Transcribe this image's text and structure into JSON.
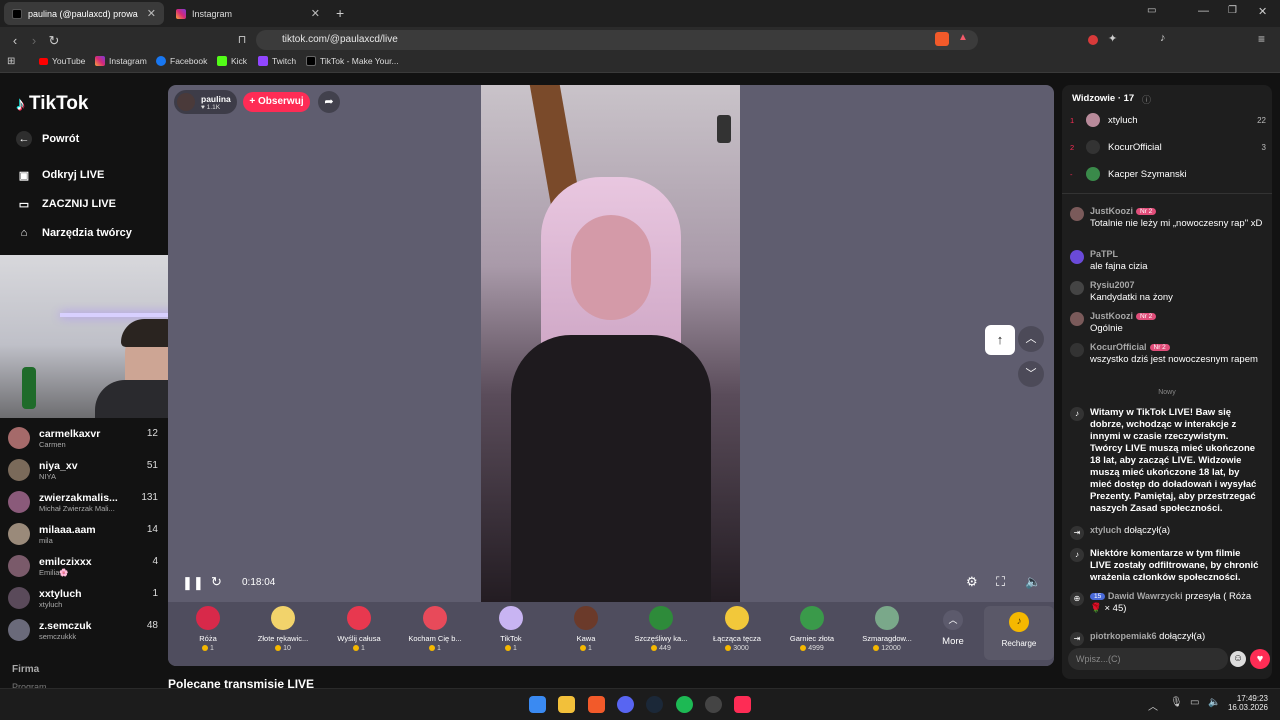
{
  "browser": {
    "tabs": [
      {
        "title": "paulina (@paulaxcd) prowadzi…",
        "active": true
      },
      {
        "title": "Instagram",
        "active": false
      }
    ],
    "new_tab": "+",
    "url": "tiktok.com/@paulaxcd/live",
    "bookmarks": [
      "YouTube",
      "Instagram",
      "Facebook",
      "Kick",
      "Twitch",
      "TikTok - Make Your..."
    ]
  },
  "sidebar": {
    "brand": "TikTok",
    "back": "Powrót",
    "nav": [
      "Odkryj LIVE",
      "ZACZNIJ LIVE",
      "Narzędzia twórcy"
    ],
    "following": [
      {
        "name": "carmelkaxvr",
        "sub": "Carmen",
        "count": "12",
        "color": "#a56a6a"
      },
      {
        "name": "niya_xv",
        "sub": "NIYA",
        "count": "51",
        "color": "#7a6a5a"
      },
      {
        "name": "zwierzakmalis...",
        "sub": "Michał Zwierzak Mali...",
        "count": "131",
        "color": "#8a5a7a"
      },
      {
        "name": "milaaa.aam",
        "sub": "mila",
        "count": "14",
        "color": "#9a8a7a"
      },
      {
        "name": "emilczixxx",
        "sub": "Emilia🌸",
        "count": "4",
        "color": "#7a5a6a"
      },
      {
        "name": "xxtyluch",
        "sub": "xtyluch",
        "count": "1",
        "color": "#5a4a5a"
      },
      {
        "name": "z.semczuk",
        "sub": "semczukkk",
        "count": "48",
        "color": "#6a6a7a"
      }
    ],
    "footer": [
      "Firma",
      "Program"
    ]
  },
  "stream": {
    "host_name": "paulina",
    "host_likes": "♥ 1.1K",
    "follow": "+ Obserwuj",
    "time": "0:18:04",
    "recommended": "Polecane transmisje LIVE"
  },
  "gifts": [
    {
      "name": "Róża",
      "price": "1",
      "color": "#d8294a"
    },
    {
      "name": "Złote rękawic...",
      "price": "10",
      "color": "#f2d36b"
    },
    {
      "name": "Wyślij całusa",
      "price": "1",
      "color": "#e8384f"
    },
    {
      "name": "Kocham Cię b...",
      "price": "1",
      "color": "#e84a5a"
    },
    {
      "name": "TikTok",
      "price": "1",
      "color": "#c8b4f2"
    },
    {
      "name": "Kawa",
      "price": "1",
      "color": "#6b3a2a"
    },
    {
      "name": "Szczęśliwy ka...",
      "price": "449",
      "color": "#2e8b3a"
    },
    {
      "name": "Łącząca tęcza",
      "price": "3000",
      "color": "#f2c83a"
    },
    {
      "name": "Garniec złota",
      "price": "4999",
      "color": "#3a9a4a"
    },
    {
      "name": "Szmaragdow...",
      "price": "12000",
      "color": "#7aa88a"
    }
  ],
  "gift_more": "More",
  "recharge": "Recharge",
  "chat": {
    "viewers_title": "Widzowie · 17",
    "viewers": [
      {
        "rank": "1",
        "name": "xtyluch",
        "count": "22",
        "color": "#b88a9a"
      },
      {
        "rank": "2",
        "name": "KocurOfficial",
        "count": "3",
        "color": "#333"
      },
      {
        "rank": "-",
        "name": "Kacper Szymanski",
        "count": "",
        "color": "#3a8a4a"
      }
    ],
    "messages": [
      {
        "user": "JustKoozi",
        "badge": "Nr 2",
        "text": "Totalnie nie leży mi „nowoczesny rap\" xD",
        "color": "#7a5a5a"
      },
      {
        "user": "PaTPL",
        "badge": "",
        "text": "ale fajna cizia",
        "color": "#6a4ad8"
      },
      {
        "user": "Rysiu2007",
        "badge": "",
        "text": "Kandydatki na żony",
        "color": "#444"
      },
      {
        "user": "JustKoozi",
        "badge": "Nr 2",
        "text": "Ogólnie",
        "color": "#7a5a5a"
      },
      {
        "user": "KocurOfficial",
        "badge": "Nr 2",
        "text": "wszystko dziś jest nowoczesnym rapem",
        "color": "#333"
      }
    ],
    "new_label": "Nowy",
    "system1": "Witamy w TikTok LIVE! Baw się dobrze, wchodząc w interakcje z innymi w czasie rzeczywistym. Twórcy LIVE muszą mieć ukończone 18 lat, aby zacząć LIVE. Widzowie muszą mieć ukończone 18 lat, by mieć dostęp do doładowań i wysyłać Prezenty. Pamiętaj, aby przestrzegać naszych Zasad społeczności.",
    "join1_user": "xtyluch",
    "join1_text": "dołączył(a)",
    "system2": "Niektóre komentarze w tym filmie LIVE zostały odfiltrowane, by chronić wrażenia członków społeczności.",
    "gift_badge": "15",
    "gift_user": "Dawid Wawrzycki",
    "gift_text": "przesyła ( Róża 🌹 × 45)",
    "join2_user": "piotrkopemiak6",
    "join2_text": "dołączył(a)",
    "input_placeholder": "Wpisz...(C)"
  },
  "taskbar": {
    "time": "17:49:23",
    "date": "16.03.2026"
  }
}
